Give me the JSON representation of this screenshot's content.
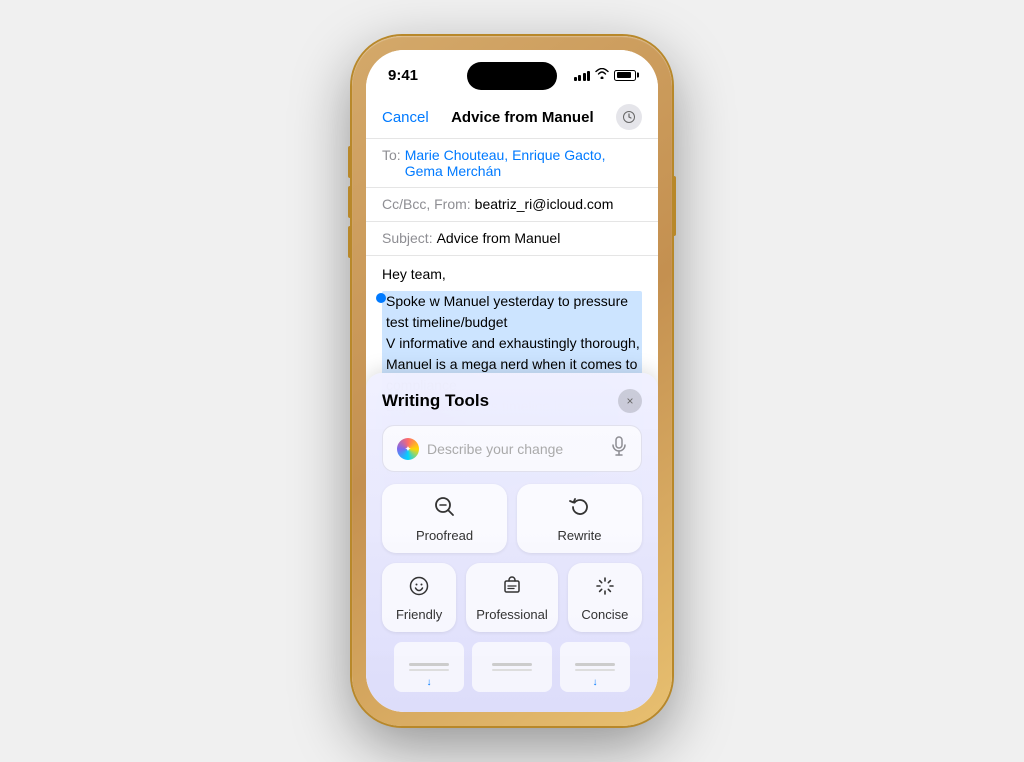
{
  "status_bar": {
    "time": "9:41",
    "signal_label": "signal",
    "wifi_label": "wifi",
    "battery_label": "battery"
  },
  "compose": {
    "cancel_label": "Cancel",
    "title": "Advice from Manuel",
    "to_label": "To:",
    "to_value": "Marie Chouteau, Enrique Gacto, Gema Merchán",
    "cc_label": "Cc/Bcc, From:",
    "cc_value": "beatriz_ri@icloud.com",
    "subject_label": "Subject:",
    "subject_value": "Advice from Manuel",
    "greeting": "Hey team,",
    "body_selected": "Spoke w Manuel yesterday to pressure test timeline/budget\nV informative and exhaustingly thorough,\nManuel is a mega nerd when it comes to compliance\nBig takeaway was timeline is realistic, we can commit with confidence, woo!\nM's firm specializes in community consultation, we need help here, should consider engaging"
  },
  "writing_tools": {
    "title": "Writing Tools",
    "close_icon": "×",
    "describe_placeholder": "Describe your change",
    "mic_icon": "🎙",
    "proofread_label": "Proofread",
    "rewrite_label": "Rewrite",
    "friendly_label": "Friendly",
    "professional_label": "Professional",
    "concise_label": "Concise"
  },
  "thumbnails": [
    {
      "arrow": "↓"
    },
    {
      "arrow": ""
    },
    {
      "arrow": "↓"
    }
  ]
}
